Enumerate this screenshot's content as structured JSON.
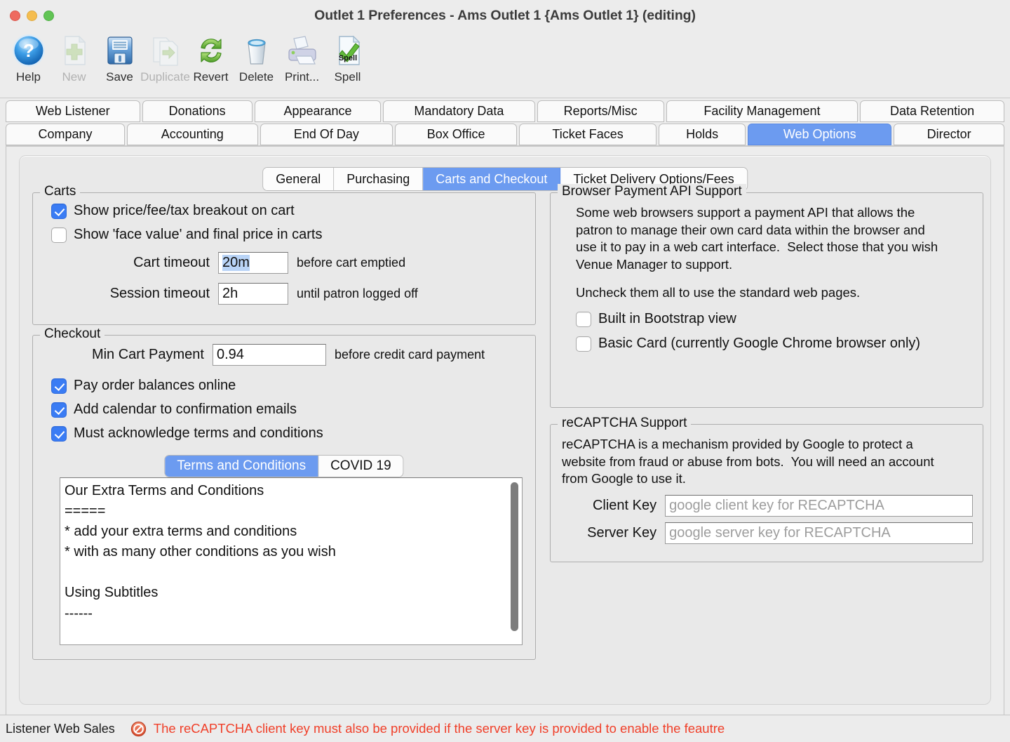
{
  "window": {
    "title": "Outlet 1 Preferences - Ams Outlet 1 {Ams Outlet 1} (editing)",
    "accent_blue": "#6c9bf0",
    "checkbox_blue": "#3a7cf4",
    "error_red": "#f0402a"
  },
  "toolbar": {
    "items": [
      {
        "label": "Help",
        "icon": "help-icon",
        "enabled": true
      },
      {
        "label": "New",
        "icon": "new-icon",
        "enabled": false
      },
      {
        "label": "Save",
        "icon": "save-icon",
        "enabled": true
      },
      {
        "label": "Duplicate",
        "icon": "duplicate-icon",
        "enabled": false
      },
      {
        "label": "Revert",
        "icon": "revert-icon",
        "enabled": true
      },
      {
        "label": "Delete",
        "icon": "delete-icon",
        "enabled": true
      },
      {
        "label": "Print...",
        "icon": "print-icon",
        "enabled": true
      },
      {
        "label": "Spell",
        "icon": "spell-icon",
        "enabled": true
      }
    ]
  },
  "tabs": {
    "row1": [
      {
        "label": "Web Listener",
        "selected": false
      },
      {
        "label": "Donations",
        "selected": false
      },
      {
        "label": "Appearance",
        "selected": false
      },
      {
        "label": "Mandatory Data",
        "selected": false
      },
      {
        "label": "Reports/Misc",
        "selected": false
      },
      {
        "label": "Facility Management",
        "selected": false
      },
      {
        "label": "Data Retention",
        "selected": false
      }
    ],
    "row2": [
      {
        "label": "Company",
        "selected": false
      },
      {
        "label": "Accounting",
        "selected": false
      },
      {
        "label": "End Of Day",
        "selected": false
      },
      {
        "label": "Box Office",
        "selected": false
      },
      {
        "label": "Ticket Faces",
        "selected": false
      },
      {
        "label": "Holds",
        "selected": false
      },
      {
        "label": "Web Options",
        "selected": true
      },
      {
        "label": "Director",
        "selected": false
      }
    ]
  },
  "subtabs": [
    {
      "label": "General",
      "selected": false
    },
    {
      "label": "Purchasing",
      "selected": false
    },
    {
      "label": "Carts and Checkout",
      "selected": true
    },
    {
      "label": "Ticket Delivery Options/Fees",
      "selected": false
    }
  ],
  "carts": {
    "legend": "Carts",
    "checkboxes": [
      {
        "label": "Show price/fee/tax breakout on cart",
        "checked": true
      },
      {
        "label": "Show 'face value' and final price in carts",
        "checked": false
      }
    ],
    "cart_timeout": {
      "label": "Cart timeout",
      "value": "20m",
      "selected": true,
      "suffix": "before cart emptied"
    },
    "session_timeout": {
      "label": "Session timeout",
      "value": "2h",
      "selected": false,
      "suffix": "until patron logged off"
    }
  },
  "checkout": {
    "legend": "Checkout",
    "min_cart_payment": {
      "label": "Min Cart Payment",
      "value": "0.94",
      "suffix": "before credit card payment"
    },
    "checkboxes": [
      {
        "label": "Pay order balances online",
        "checked": true
      },
      {
        "label": "Add calendar to confirmation emails",
        "checked": true
      },
      {
        "label": "Must acknowledge terms and conditions",
        "checked": true
      }
    ],
    "tc_tabs": [
      {
        "label": "Terms and Conditions",
        "selected": true
      },
      {
        "label": "COVID 19",
        "selected": false
      }
    ],
    "tc_text": "Our Extra Terms and Conditions\n=====\n* add your extra terms and conditions\n* with as many other conditions as you wish\n\nUsing Subtitles\n------\n\nand even more text"
  },
  "browser_api": {
    "legend": "Browser Payment API Support",
    "paragraph1": "Some web browsers support a payment API that allows the\npatron to manage their own card data within the browser and\nuse it to pay in a web cart interface.  Select those that you wish\nVenue Manager to support.",
    "paragraph2": "Uncheck them all to use the standard web pages.",
    "checkboxes": [
      {
        "label": "Built in Bootstrap view",
        "checked": false
      },
      {
        "label": "Basic Card (currently Google Chrome browser only)",
        "checked": false
      }
    ]
  },
  "recaptcha": {
    "legend": "reCAPTCHA Support",
    "paragraph": "reCAPTCHA is a mechanism provided by Google to protect a\nwebsite from fraud or abuse from bots.  You will need an account\nfrom Google to use it.",
    "client_key": {
      "label": "Client Key",
      "value": "",
      "placeholder": "google client key for RECAPTCHA"
    },
    "server_key": {
      "label": "Server Key",
      "value": "",
      "placeholder": "google server key for RECAPTCHA"
    }
  },
  "statusbar": {
    "left_label": "Listener Web Sales",
    "icon": "no-entry-icon",
    "message": "The reCAPTCHA client key must also be provided if the server key is provided to enable the feautre"
  }
}
